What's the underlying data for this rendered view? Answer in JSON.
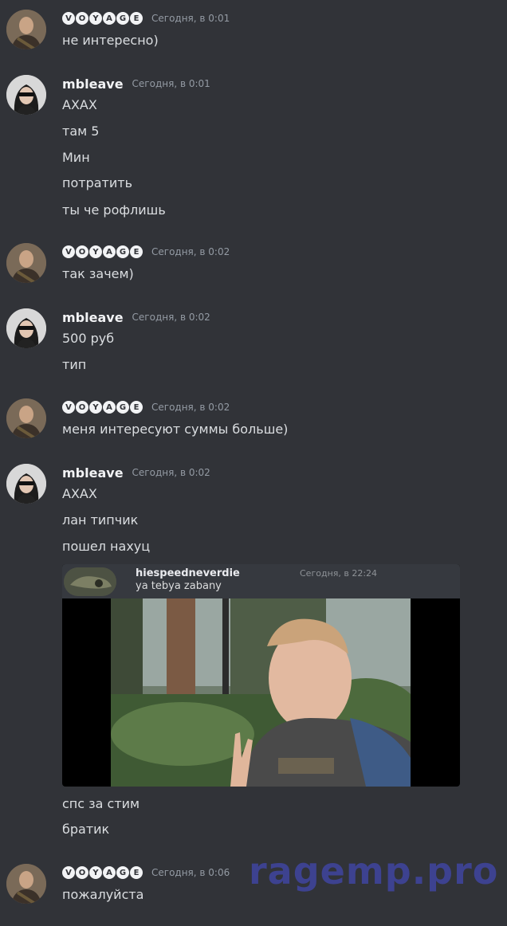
{
  "messages": [
    {
      "author": "VOYAGE",
      "author_letters": [
        "V",
        "O",
        "Y",
        "A",
        "G",
        "E"
      ],
      "timestamp": "Сегодня, в 0:01",
      "lines": [
        "не интересно)"
      ]
    },
    {
      "author": "mbleave",
      "timestamp": "Сегодня, в 0:01",
      "lines": [
        "АХАХ",
        "там 5",
        "Мин",
        "потратить",
        "ты че рофлишь"
      ]
    },
    {
      "author": "VOYAGE",
      "author_letters": [
        "V",
        "O",
        "Y",
        "A",
        "G",
        "E"
      ],
      "timestamp": "Сегодня, в 0:02",
      "lines": [
        "так зачем)"
      ]
    },
    {
      "author": "mbleave",
      "timestamp": "Сегодня, в 0:02",
      "lines": [
        "500 руб",
        "тип"
      ]
    },
    {
      "author": "VOYAGE",
      "author_letters": [
        "V",
        "O",
        "Y",
        "A",
        "G",
        "E"
      ],
      "timestamp": "Сегодня, в 0:02",
      "lines": [
        "меня интересуют суммы больше)"
      ]
    },
    {
      "author": "mbleave",
      "timestamp": "Сегодня, в 0:02",
      "lines": [
        "АХАХ",
        "лан типчик",
        "пошел нахуц",
        "спс за стим",
        "братик"
      ],
      "embed": {
        "author": "hiespeedneverdie",
        "timestamp": "Сегодня, в 22:24",
        "text": "ya tebya zabany",
        "photo": "selfie-in-forest"
      }
    },
    {
      "author": "VOYAGE",
      "author_letters": [
        "V",
        "O",
        "Y",
        "A",
        "G",
        "E"
      ],
      "timestamp": "Сегодня, в 0:06",
      "lines": [
        "пожалуйста"
      ]
    }
  ],
  "watermark": "ragemp.pro",
  "colors": {
    "background": "#313338",
    "text": "#dbdee1",
    "username": "#f2f3f5",
    "timestamp": "#949ba4",
    "watermark": "#3d4290"
  }
}
